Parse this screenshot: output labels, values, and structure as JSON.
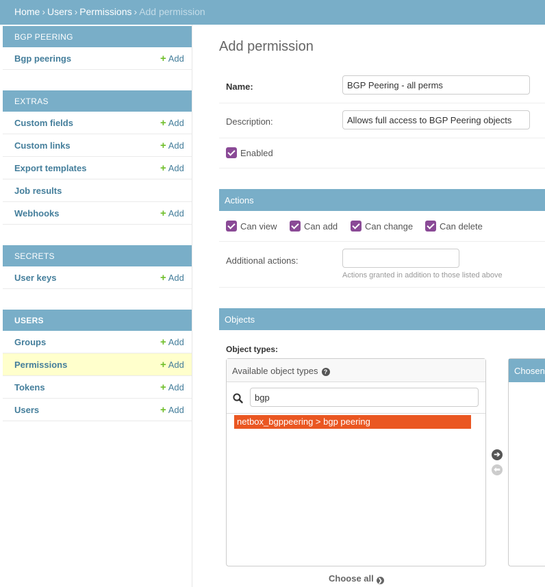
{
  "breadcrumb": {
    "items": [
      "Home",
      "Users",
      "Permissions"
    ],
    "separator": "›",
    "current": "Add permission"
  },
  "sidebar": {
    "add_label": "Add",
    "modules": [
      {
        "title": "BGP PEERING",
        "rows": [
          {
            "label": "Bgp peerings",
            "add": true
          }
        ]
      },
      {
        "title": "EXTRAS",
        "rows": [
          {
            "label": "Custom fields",
            "add": true
          },
          {
            "label": "Custom links",
            "add": true
          },
          {
            "label": "Export templates",
            "add": true
          },
          {
            "label": "Job results",
            "add": false
          },
          {
            "label": "Webhooks",
            "add": true
          }
        ]
      },
      {
        "title": "SECRETS",
        "rows": [
          {
            "label": "User keys",
            "add": true
          }
        ]
      },
      {
        "title": "USERS",
        "rows": [
          {
            "label": "Groups",
            "add": true
          },
          {
            "label": "Permissions",
            "add": true,
            "selected": true
          },
          {
            "label": "Tokens",
            "add": true
          },
          {
            "label": "Users",
            "add": true
          }
        ]
      }
    ]
  },
  "main": {
    "title": "Add permission",
    "name_label": "Name:",
    "name_value": "BGP Peering - all perms",
    "description_label": "Description:",
    "description_value": "Allows full access to BGP Peering objects",
    "enabled_label": "Enabled",
    "enabled": true,
    "actions_header": "Actions",
    "actions": [
      {
        "label": "Can view",
        "checked": true
      },
      {
        "label": "Can add",
        "checked": true
      },
      {
        "label": "Can change",
        "checked": true
      },
      {
        "label": "Can delete",
        "checked": true
      }
    ],
    "additional_actions_label": "Additional actions:",
    "additional_actions_value": "",
    "additional_actions_help": "Actions granted in addition to those listed above",
    "objects_header": "Objects",
    "object_types_label": "Object types:",
    "available_title": "Available object types",
    "filter_value": "bgp",
    "available_options": [
      "netbox_bgppeering > bgp peering"
    ],
    "chosen_title": "Chosen object types",
    "choose_all_label": "Choose all"
  },
  "colors": {
    "header": "#79aec8",
    "link": "#447e9b",
    "add_plus": "#70bf2b",
    "checkbox": "#8a4a96",
    "selected_row": "#ffffcc",
    "option_highlight": "#ea5722"
  }
}
